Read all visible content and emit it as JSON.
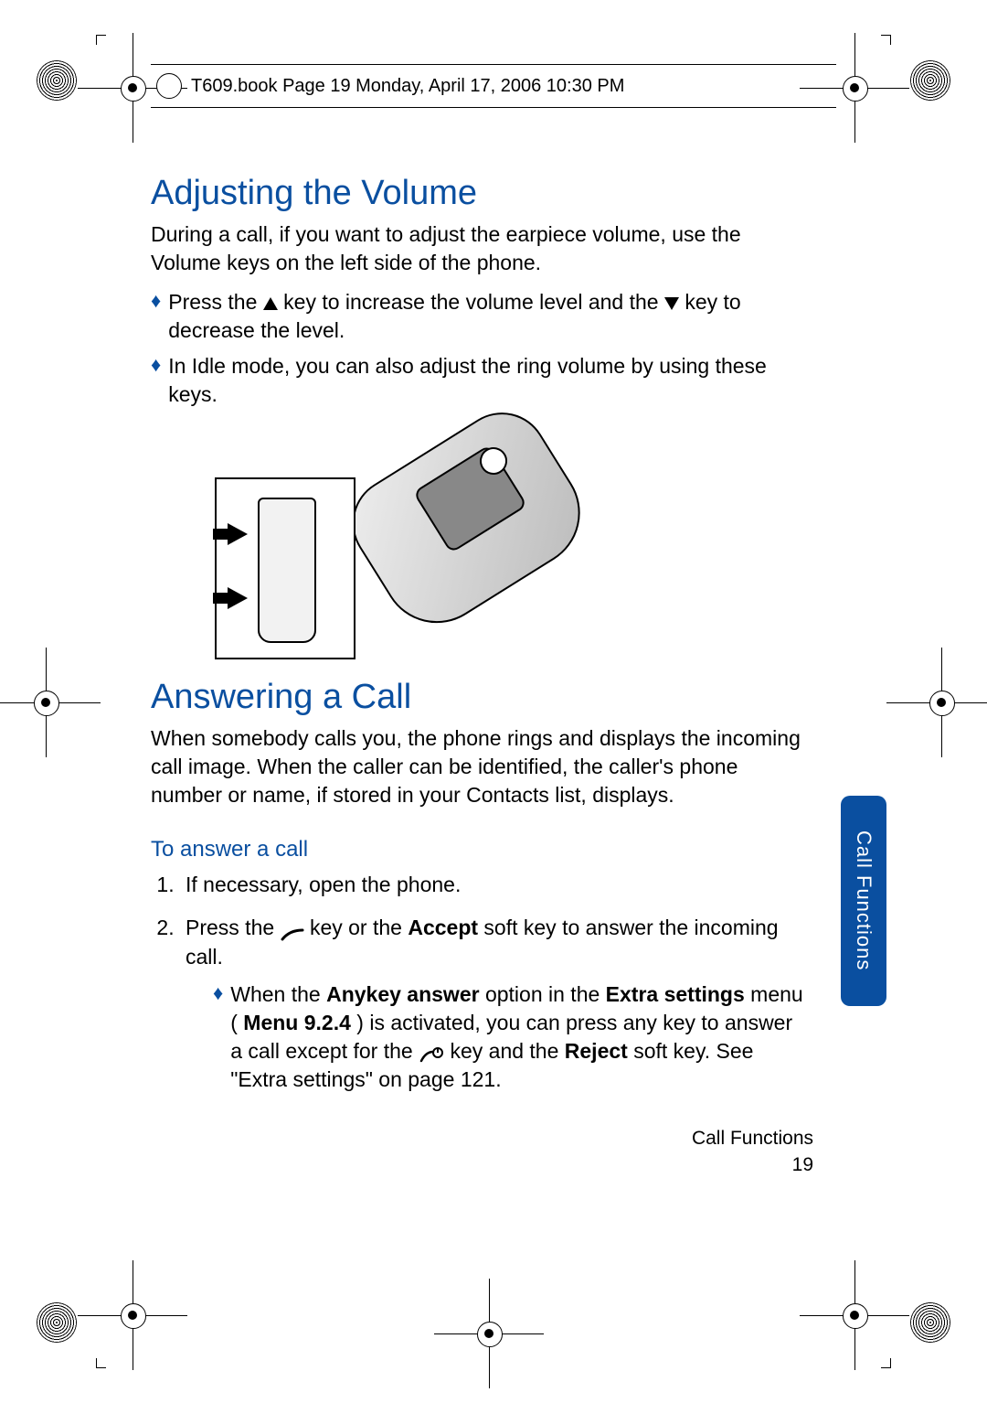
{
  "header": {
    "running": "T609.book  Page 19  Monday, April 17, 2006  10:30 PM"
  },
  "section1": {
    "title": "Adjusting the Volume",
    "intro": "During a call, if you want to adjust the earpiece volume, use the Volume keys on the left side of the phone.",
    "b1_a": "Press the ",
    "b1_b": " key to increase the volume level and the ",
    "b1_c": " key to decrease the level.",
    "b2": "In Idle mode, you can also adjust the ring volume by using these keys."
  },
  "section2": {
    "title": "Answering a Call",
    "intro": "When somebody calls you, the phone rings and displays the incoming call image. When the caller can be identified, the caller's phone number or name, if stored in your Contacts list, displays.",
    "sub": "To answer a call",
    "step1": "If necessary, open the phone.",
    "step2_a": "Press the ",
    "step2_b": " key or the ",
    "step2_accept": "Accept",
    "step2_c": " soft key to answer the incoming call.",
    "inner_a": "When the ",
    "inner_anykey": "Anykey answer",
    "inner_b": " option in the ",
    "inner_extra": "Extra settings",
    "inner_c": " menu (",
    "inner_menu": "Menu 9.2.4",
    "inner_d": ") is activated, you can press any key to answer a call except for the ",
    "inner_e": " key and the ",
    "inner_reject": "Reject",
    "inner_f": " soft key. See \"Extra settings\" on page 121."
  },
  "tab": {
    "label": "Call Functions"
  },
  "footer": {
    "chapter": "Call Functions",
    "page": "19"
  }
}
